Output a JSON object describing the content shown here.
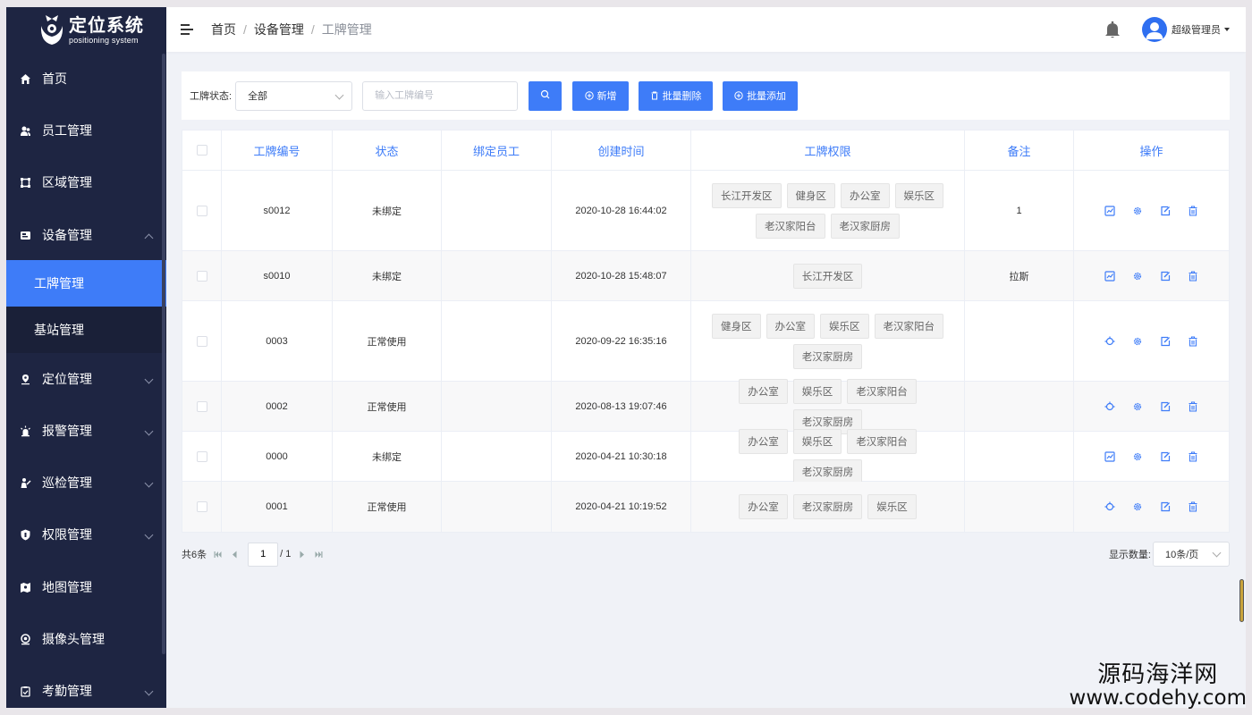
{
  "app": {
    "logo_title": "定位系统",
    "logo_subtitle": "positioning system"
  },
  "sidebar": {
    "items": [
      {
        "label": "首页",
        "icon": "home-icon"
      },
      {
        "label": "员工管理",
        "icon": "users-icon"
      },
      {
        "label": "区域管理",
        "icon": "area-icon"
      },
      {
        "label": "设备管理",
        "icon": "device-icon",
        "expanded": true
      },
      {
        "label": "定位管理",
        "icon": "location-icon"
      },
      {
        "label": "报警管理",
        "icon": "alarm-icon"
      },
      {
        "label": "巡检管理",
        "icon": "patrol-icon"
      },
      {
        "label": "权限管理",
        "icon": "shield-icon"
      },
      {
        "label": "地图管理",
        "icon": "map-icon"
      },
      {
        "label": "摄像头管理",
        "icon": "camera-icon"
      },
      {
        "label": "考勤管理",
        "icon": "attendance-icon"
      }
    ],
    "sub_items": [
      {
        "label": "工牌管理",
        "active": true
      },
      {
        "label": "基站管理",
        "active": false
      }
    ]
  },
  "header": {
    "breadcrumb": [
      "首页",
      "设备管理",
      "工牌管理"
    ],
    "user_name": "超级管理员"
  },
  "filter": {
    "status_label": "工牌状态:",
    "status_value": "全部",
    "search_placeholder": "输入工牌编号",
    "add_label": "新增",
    "batch_delete_label": "批量删除",
    "batch_add_label": "批量添加"
  },
  "table": {
    "headers": [
      "工牌编号",
      "状态",
      "绑定员工",
      "创建时间",
      "工牌权限",
      "备注",
      "操作"
    ],
    "rows": [
      {
        "id": "s0012",
        "status": "未绑定",
        "employee": "",
        "created": "2020-10-28 16:44:02",
        "perms": [
          "长江开发区",
          "健身区",
          "办公室",
          "娱乐区",
          "老汉家阳台",
          "老汉家厨房"
        ],
        "note": "1",
        "bound": false
      },
      {
        "id": "s0010",
        "status": "未绑定",
        "employee": "",
        "created": "2020-10-28 15:48:07",
        "perms": [
          "长江开发区"
        ],
        "note": "拉斯",
        "bound": false
      },
      {
        "id": "0003",
        "status": "正常使用",
        "employee": "",
        "created": "2020-09-22 16:35:16",
        "perms": [
          "健身区",
          "办公室",
          "娱乐区",
          "老汉家阳台",
          "老汉家厨房"
        ],
        "note": "",
        "bound": true
      },
      {
        "id": "0002",
        "status": "正常使用",
        "employee": "",
        "created": "2020-08-13 19:07:46",
        "perms": [
          "办公室",
          "娱乐区",
          "老汉家阳台",
          "老汉家厨房"
        ],
        "note": "",
        "bound": true
      },
      {
        "id": "0000",
        "status": "未绑定",
        "employee": "",
        "created": "2020-04-21 10:30:18",
        "perms": [
          "办公室",
          "娱乐区",
          "老汉家阳台",
          "老汉家厨房"
        ],
        "note": "",
        "bound": false
      },
      {
        "id": "0001",
        "status": "正常使用",
        "employee": "",
        "created": "2020-04-21 10:19:52",
        "perms": [
          "办公室",
          "老汉家厨房",
          "娱乐区"
        ],
        "note": "",
        "bound": true
      }
    ]
  },
  "pager": {
    "total": "共6条",
    "page": "1",
    "of": "/ 1",
    "size_label": "显示数量:",
    "size_value": "10条/页"
  },
  "watermark": {
    "line1": "源码海洋网",
    "line2": "www.codehy.com"
  },
  "colors": {
    "sidebar_bg": "#1e2542",
    "accent": "#3e7cf8",
    "page_bg": "#f0f2f7"
  }
}
